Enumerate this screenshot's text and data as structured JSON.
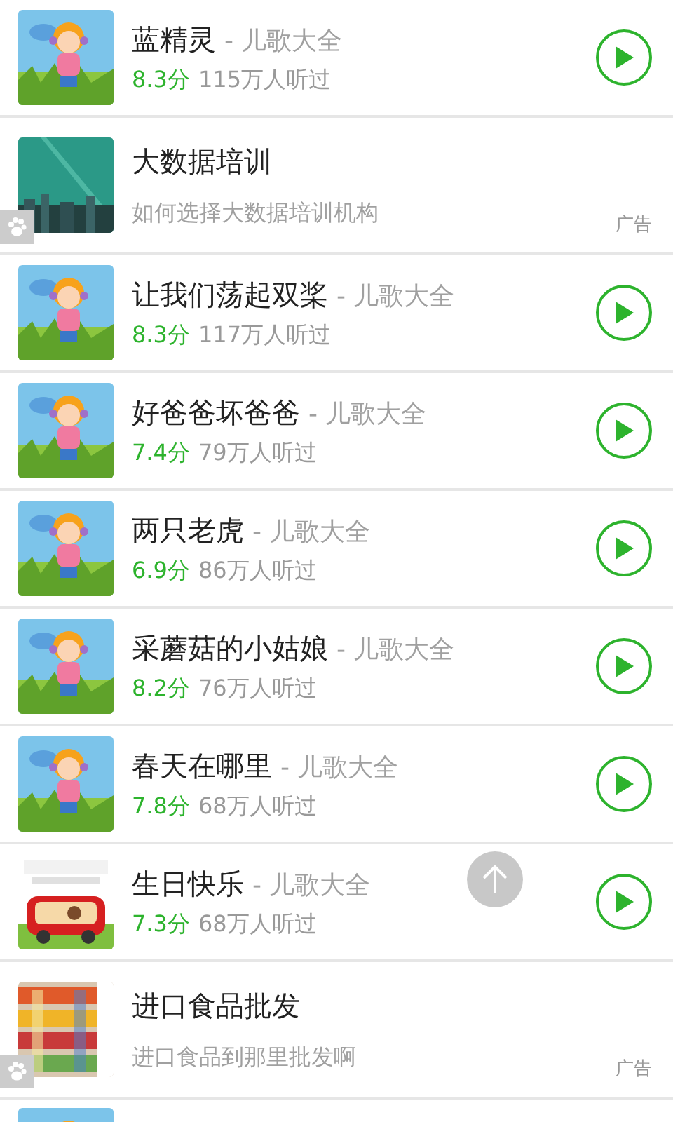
{
  "rows": [
    {
      "kind": "song",
      "title": "蓝精灵",
      "album": "- 儿歌大全",
      "score": "8.3分",
      "plays": "115万人听过"
    },
    {
      "kind": "ad",
      "title": "大数据培训",
      "description": "如何选择大数据培训机构",
      "badge": "广告"
    },
    {
      "kind": "song",
      "title": "让我们荡起双桨",
      "album": "- 儿歌大全",
      "score": "8.3分",
      "plays": "117万人听过"
    },
    {
      "kind": "song",
      "title": "好爸爸坏爸爸",
      "album": "- 儿歌大全",
      "score": "7.4分",
      "plays": "79万人听过"
    },
    {
      "kind": "song",
      "title": "两只老虎",
      "album": "- 儿歌大全",
      "score": "6.9分",
      "plays": "86万人听过"
    },
    {
      "kind": "song",
      "title": "采蘑菇的小姑娘",
      "album": "- 儿歌大全",
      "score": "8.2分",
      "plays": "76万人听过"
    },
    {
      "kind": "song",
      "title": "春天在哪里",
      "album": "- 儿歌大全",
      "score": "7.8分",
      "plays": "68万人听过"
    },
    {
      "kind": "song",
      "title": "生日快乐",
      "album": "- 儿歌大全",
      "score": "7.3分",
      "plays": "68万人听过"
    },
    {
      "kind": "ad",
      "title": "进口食品批发",
      "description": "进口食品到那里批发啊",
      "badge": "广告"
    },
    {
      "kind": "partial"
    }
  ]
}
